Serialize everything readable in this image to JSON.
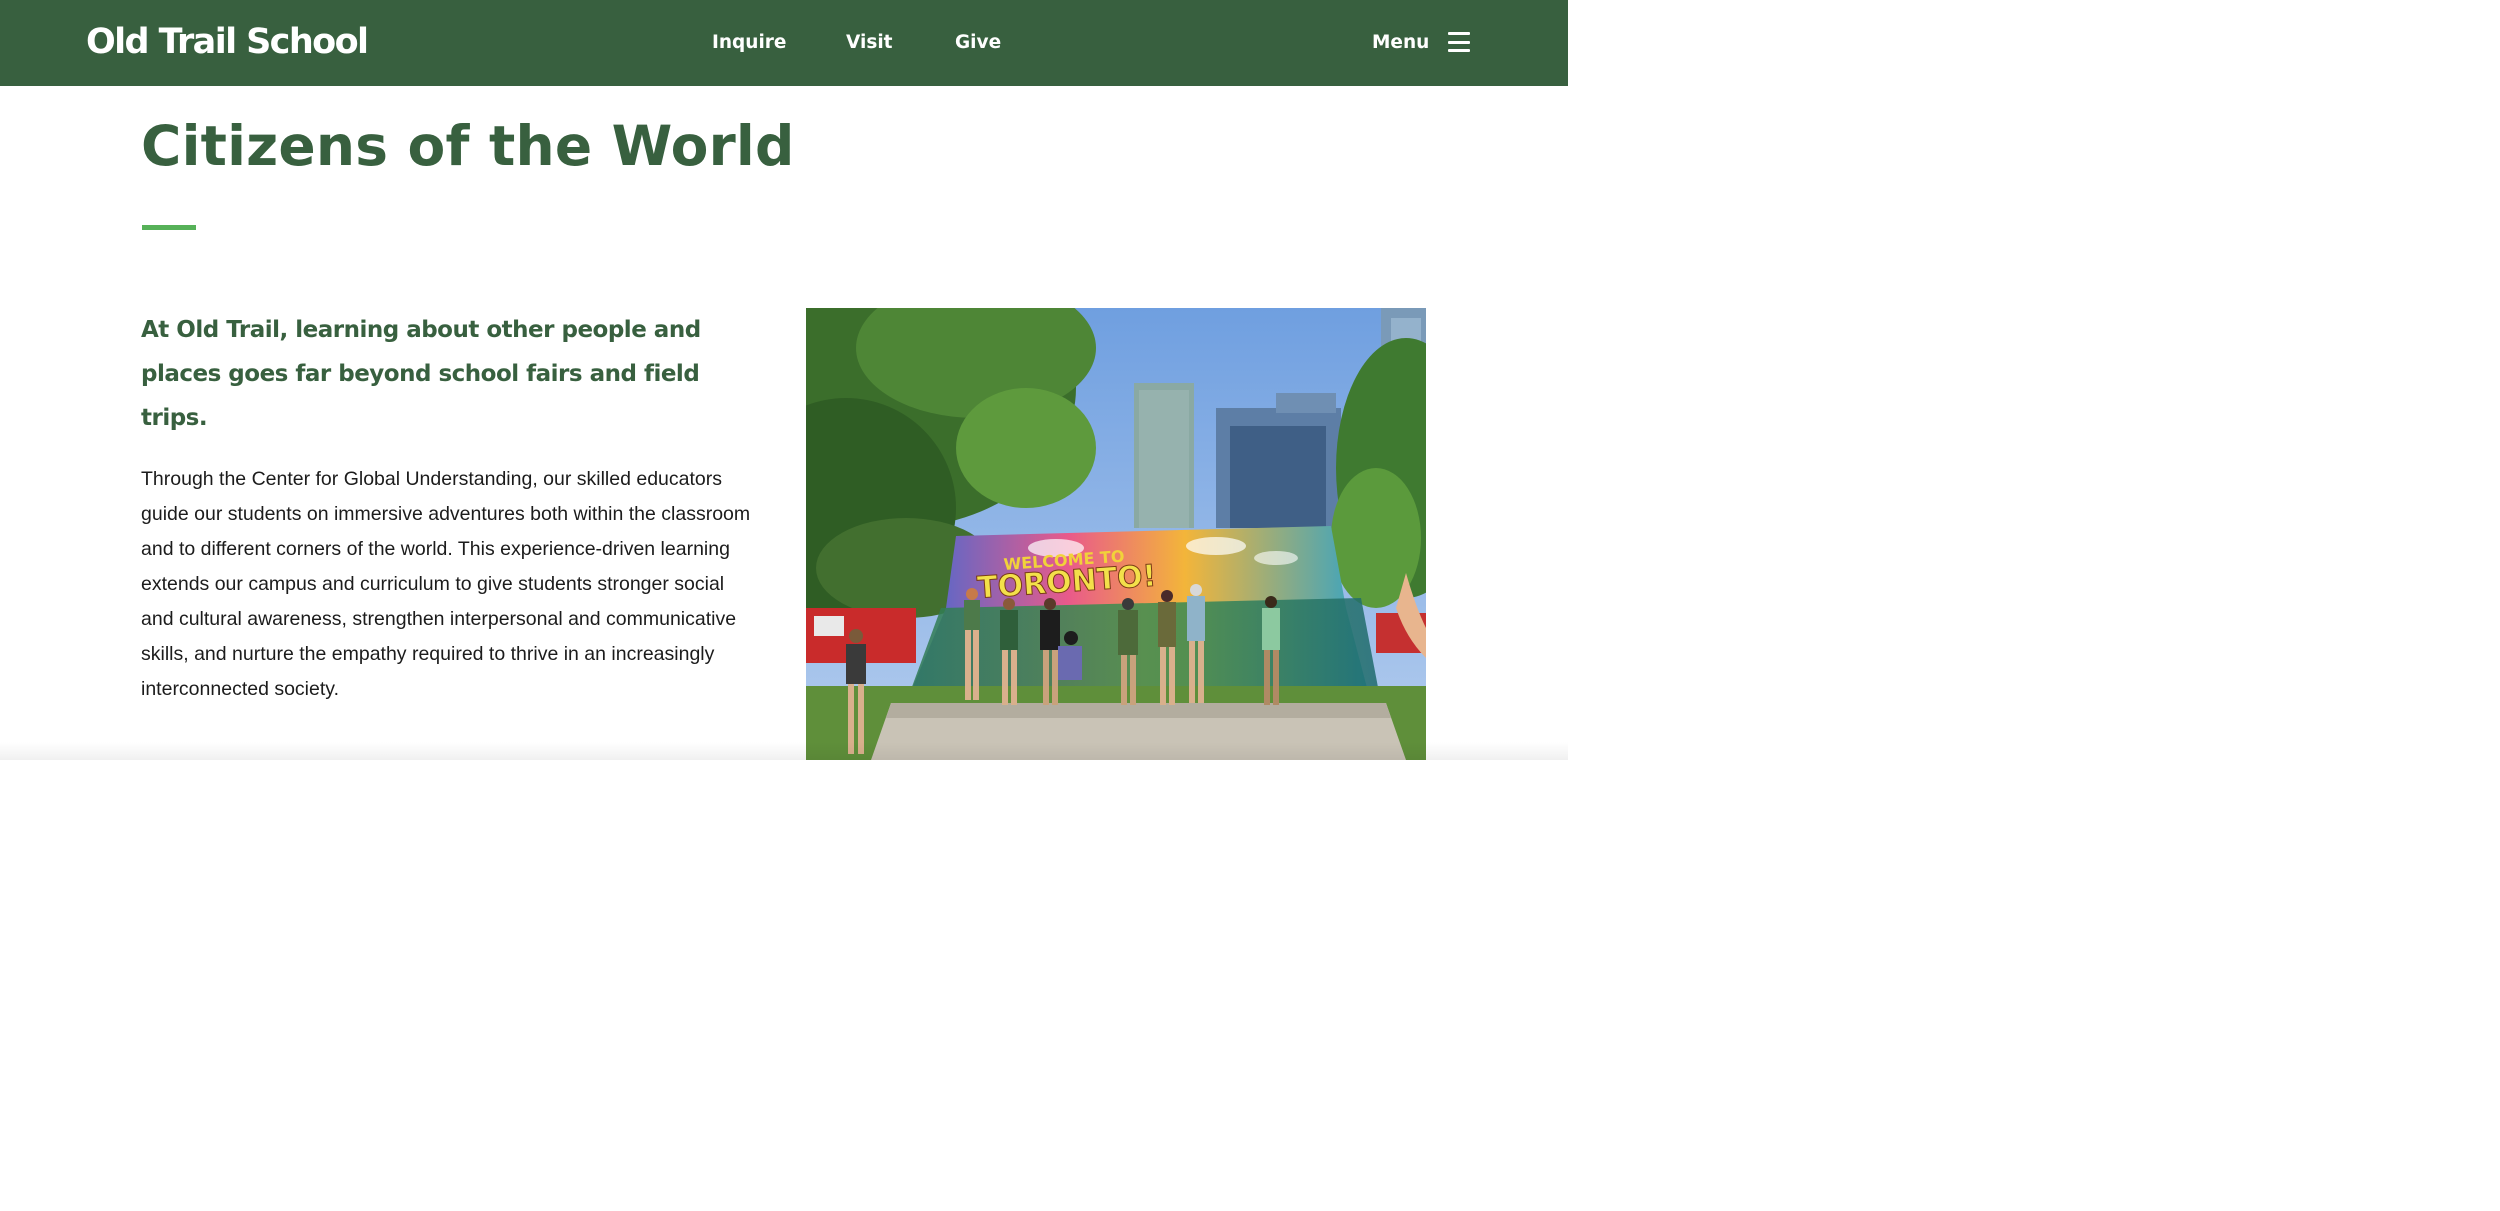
{
  "header": {
    "logo_text": "Old Trail School",
    "nav": {
      "inquire": "Inquire",
      "visit": "Visit",
      "give": "Give"
    },
    "menu_label": "Menu",
    "menu_icon": "hamburger-icon"
  },
  "main": {
    "title": "Citizens of the World",
    "lead": "At Old Trail, learning about other people and places goes far beyond school fairs and field trips.",
    "body": "Through the Center for Global Understanding, our skilled educators guide our students on immersive adventures both within the classroom and to different corners of the world. This experience-driven learning extends our campus and curriculum to give students stronger social and cultural awareness, strengthen interpersonal and communicative skills, and nurture the empathy required to thrive in an increasingly interconnected society."
  },
  "photo": {
    "sign_text_line1": "WELCOME TO",
    "sign_text_line2": "TORONTO!"
  },
  "colors": {
    "brand_green": "#38603f",
    "accent_green": "#56b158",
    "body_text": "#1c1c1c"
  }
}
